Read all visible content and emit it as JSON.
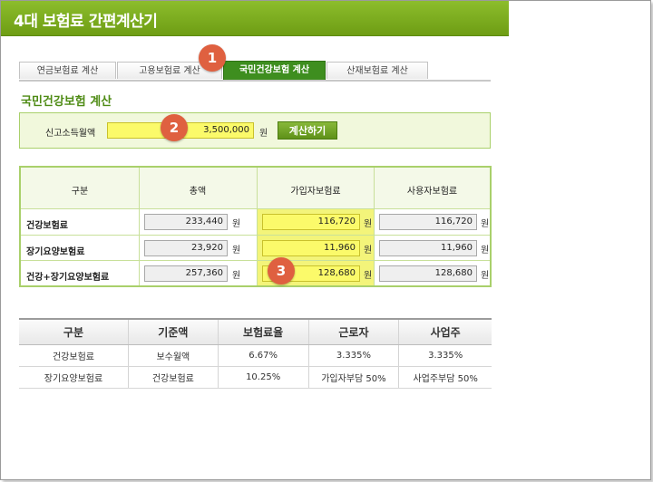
{
  "app": {
    "title": "4대 보험료 간편계산기"
  },
  "tabs": [
    {
      "label": "연금보험료 계산"
    },
    {
      "label": "고용보험료 계산"
    },
    {
      "label": "국민건강보험 계산"
    },
    {
      "label": "산재보험료 계산"
    }
  ],
  "section": {
    "title": "국민건강보험 계산"
  },
  "income": {
    "label": "신고소득월액",
    "value": "3,500,000",
    "unit": "원",
    "calc_label": "계산하기"
  },
  "markers": [
    "1",
    "2",
    "3"
  ],
  "result": {
    "headers": [
      "구분",
      "총액",
      "가입자보험료",
      "사용자보험료"
    ],
    "unit": "원",
    "rows": [
      {
        "label": "건강보험료",
        "total": "233,440",
        "employee": "116,720",
        "employer": "116,720"
      },
      {
        "label": "장기요양보험료",
        "total": "23,920",
        "employee": "11,960",
        "employer": "11,960"
      },
      {
        "label": "건강+장기요양보험료",
        "total": "257,360",
        "employee": "128,680",
        "employer": "128,680"
      }
    ]
  },
  "rates": {
    "headers": [
      "구분",
      "기준액",
      "보험료율",
      "근로자",
      "사업주"
    ],
    "rows": [
      [
        "건강보험료",
        "보수월액",
        "6.67%",
        "3.335%",
        "3.335%"
      ],
      [
        "장기요양보험료",
        "건강보험료",
        "10.25%",
        "가입자부담 50%",
        "사업주부담 50%"
      ]
    ]
  },
  "colors": {
    "accent": "#6e9d14",
    "highlight": "#fbfa6a",
    "marker": "#df6040"
  }
}
